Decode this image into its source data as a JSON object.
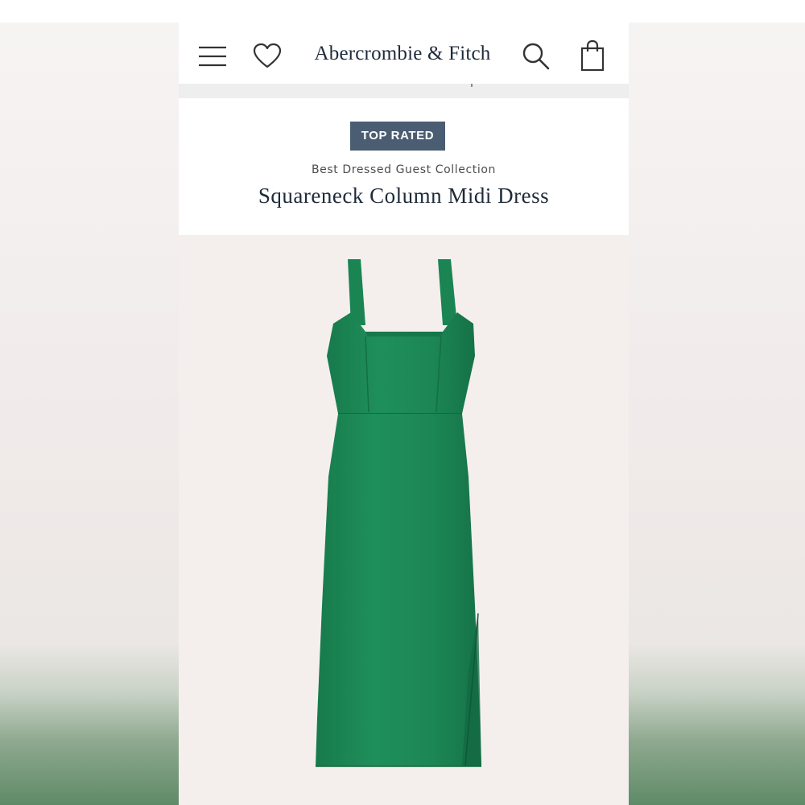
{
  "header": {
    "brand": "Abercrombie & Fitch",
    "menu_icon": "hamburger-menu-icon",
    "wishlist_icon": "heart-icon",
    "search_icon": "search-icon",
    "bag_icon": "shopping-bag-icon"
  },
  "product": {
    "badge": "TOP RATED",
    "collection": "Best Dressed Guest Collection",
    "title": "Squareneck Column Midi Dress",
    "image_alt": "green-midi-dress-image"
  },
  "colors": {
    "badge_bg": "#4a5d73",
    "brand_text": "#1f2a3a",
    "dress_green": "#1f8a58",
    "image_bg": "#f4efed"
  }
}
